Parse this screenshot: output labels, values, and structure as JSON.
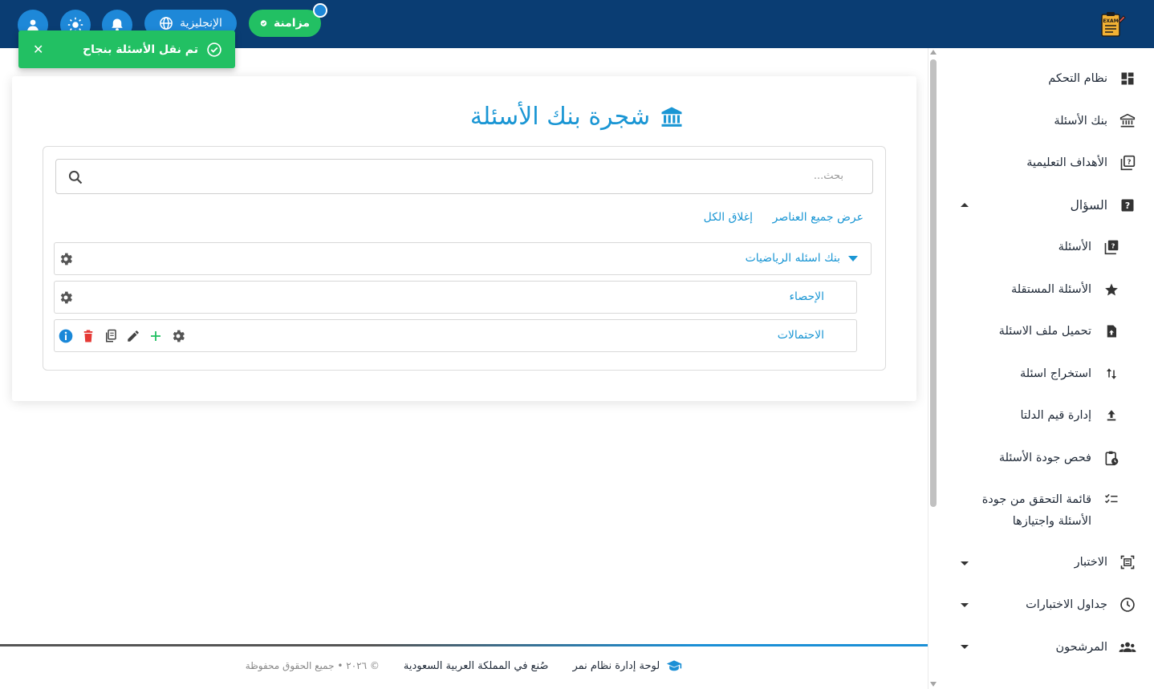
{
  "topbar": {
    "sync_label": "مزامنة",
    "language_label": "الإنجليزية",
    "logo_text": "EXAM"
  },
  "toast": {
    "message": "تم نقل الأسئلة بنجاح",
    "close_symbol": "✕"
  },
  "page": {
    "title": "شجرة بنك الأسئلة"
  },
  "tree": {
    "search_placeholder": "بحث...",
    "show_all": "عرض جميع العناصر",
    "collapse_all": "إغلاق الكل",
    "nodes": [
      {
        "label": "بنك اسئله الرياضيات"
      },
      {
        "label": "الإحصاء"
      },
      {
        "label": "الاحتمالات"
      }
    ]
  },
  "sidebar": {
    "items": [
      {
        "label": "نظام التحكم",
        "icon": "dashboard-icon"
      },
      {
        "label": "بنك الأسئلة",
        "icon": "bank-icon"
      },
      {
        "label": "الأهداف التعليمية",
        "icon": "objectives-icon"
      },
      {
        "label": "السؤال",
        "icon": "question-icon"
      },
      {
        "label": "الأسئلة",
        "icon": "questions-icon"
      },
      {
        "label": "الأسئلة المستقلة",
        "icon": "star-icon"
      },
      {
        "label": "تحميل ملف الاسئلة",
        "icon": "file-upload-icon"
      },
      {
        "label": "استخراج اسئلة",
        "icon": "sort-icon"
      },
      {
        "label": "إدارة قيم الدلتا",
        "icon": "upload-icon"
      },
      {
        "label": "فحص جودة الأسئلة",
        "icon": "clipboard-clock-icon"
      },
      {
        "label": "قائمة التحقق من جودة الأسئلة واجتيازها",
        "icon": "checklist-icon"
      },
      {
        "label": "الاختبار",
        "icon": "exam-icon"
      },
      {
        "label": "جداول الاختبارات",
        "icon": "clock-icon"
      },
      {
        "label": "المرشحون",
        "icon": "people-icon"
      }
    ]
  },
  "footer": {
    "brand": "لوحة إدارة نظام نمر",
    "made_in": "صُنع في المملكة العربية السعودية",
    "copyright": "© ٢٠٢٦ • جميع الحقوق محفوظة"
  },
  "colors": {
    "topbar": "#0a3d73",
    "accent": "#1a96d4",
    "success": "#22c063",
    "danger": "#e53935"
  }
}
